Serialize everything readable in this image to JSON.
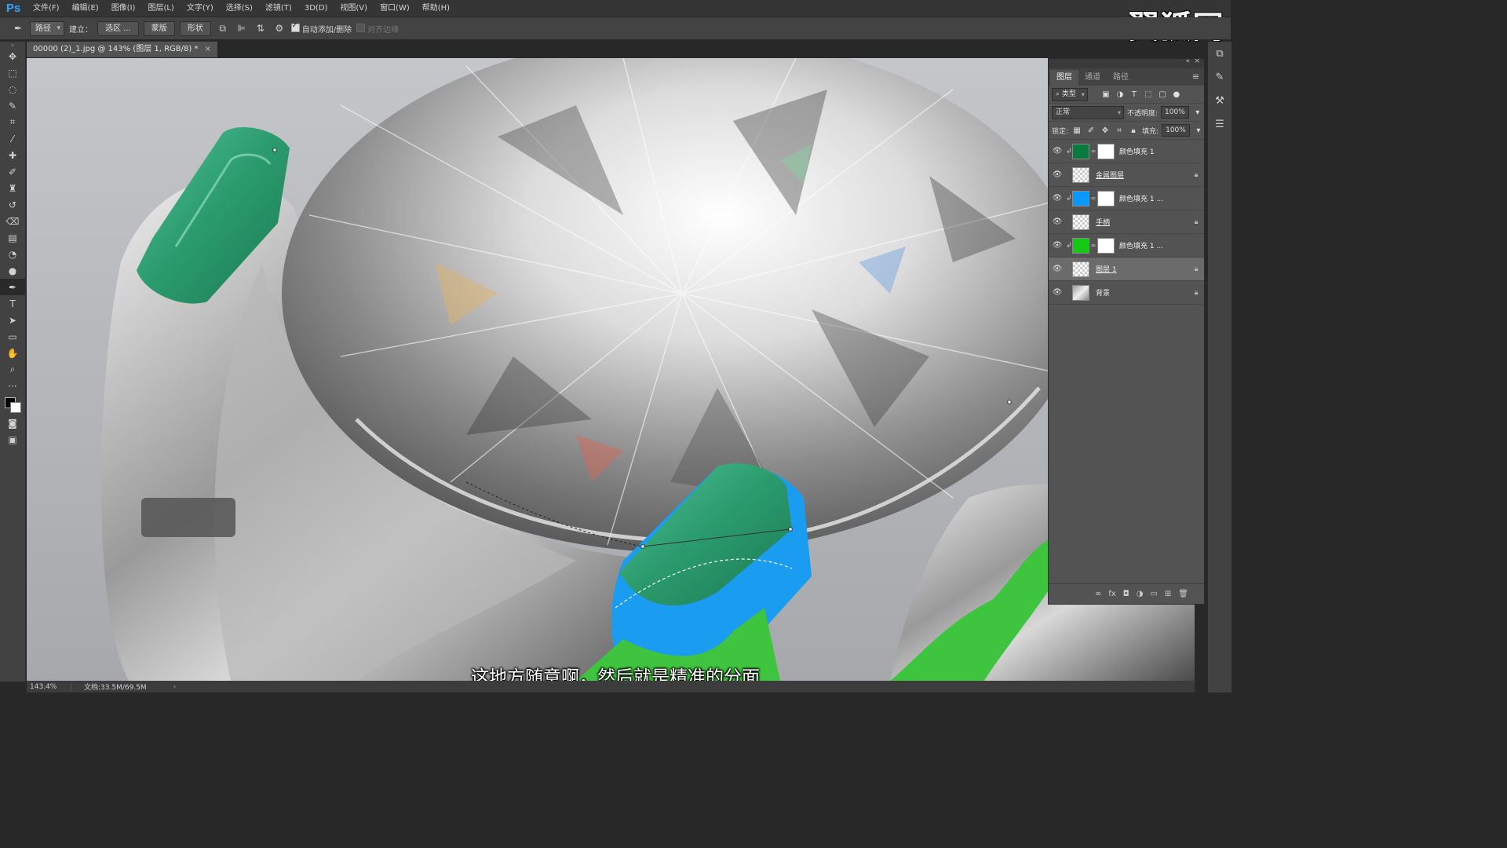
{
  "app": {
    "logo": "Ps",
    "watermark": "翼狐网"
  },
  "menu": [
    "文件(F)",
    "编辑(E)",
    "图像(I)",
    "图层(L)",
    "文字(Y)",
    "选择(S)",
    "滤镜(T)",
    "3D(D)",
    "视图(V)",
    "窗口(W)",
    "帮助(H)"
  ],
  "options": {
    "mode_select": "路径",
    "make_label": "建立：",
    "selection_btn": "选区 ...",
    "mask_btn": "蒙版",
    "shape_btn": "形状",
    "auto_add_delete": "自动添加/删除",
    "align_edges": "对齐边缘"
  },
  "document": {
    "tab_title": "00000 (2)_1.jpg @ 143% (图层 1, RGB/8) *",
    "close": "×"
  },
  "status": {
    "zoom": "143.4%",
    "doc_size": "文档:33.5M/69.5M",
    "arrow": "›"
  },
  "subtitle": "这地方随意啊，然后就是精准的分面",
  "layers_panel": {
    "tabs": [
      "图层",
      "通道",
      "路径"
    ],
    "filter_kind": "类型",
    "blend_mode": "正常",
    "opacity_label": "不透明度:",
    "opacity_value": "100%",
    "lock_label": "锁定:",
    "fill_label": "填充:",
    "fill_value": "100%",
    "layers": [
      {
        "name": "颜色填充 1",
        "thumb_color": "#0b7a3c",
        "type": "fill",
        "clipped": true
      },
      {
        "name": "金属图层",
        "type": "raster",
        "locked": true
      },
      {
        "name": "颜色填充 1 ...",
        "thumb_color": "#0a98ff",
        "type": "fill",
        "clipped": true
      },
      {
        "name": "手柄",
        "type": "raster",
        "locked": true
      },
      {
        "name": "颜色填充 1 ...",
        "thumb_color": "#14c814",
        "type": "fill",
        "clipped": true
      },
      {
        "name": "图层 1",
        "type": "raster",
        "locked": true,
        "selected": true
      },
      {
        "name": "背景",
        "type": "photo",
        "locked": true
      }
    ]
  },
  "colors": {
    "accent_blue": "#31a8ff",
    "prong_green": "#2a9a6c",
    "fill_blue": "#1a9cf0",
    "fill_green": "#3ec43e"
  }
}
